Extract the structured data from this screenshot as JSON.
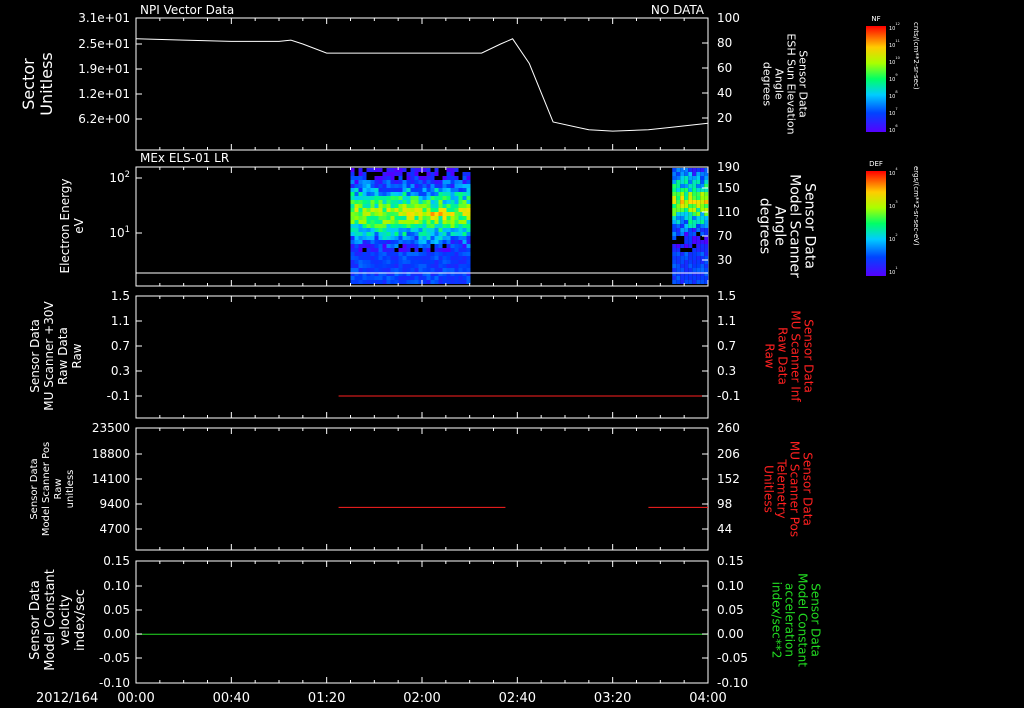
{
  "date_label": "2012/164",
  "time_ticks": [
    "00:00",
    "00:40",
    "01:20",
    "02:00",
    "02:40",
    "03:20",
    "04:00"
  ],
  "colors": {
    "red": "#ff2020",
    "green": "#22dd22",
    "white": "#ffffff"
  },
  "panels": [
    {
      "id": "sector",
      "title_left": "NPI Vector Data",
      "title_right": "NO DATA",
      "left_label": [
        "Sector",
        "Unitless"
      ],
      "right_label": [
        "Sensor Data",
        "ESH Sun Elevation",
        "Angle",
        "degrees"
      ],
      "left_ticks": [
        "3.1e+01",
        "2.5e+01",
        "1.9e+01",
        "1.2e+01",
        "6.2e+00"
      ],
      "right_ticks": [
        "100",
        "80",
        "60",
        "40",
        "20"
      ]
    },
    {
      "id": "els",
      "title_left": "MEx ELS-01 LR",
      "left_label": [
        "Electron Energy",
        "eV"
      ],
      "right_label": [
        "Sensor Data",
        "Model Scanner",
        "Angle",
        "degrees"
      ],
      "left_ticks": [
        "10^2",
        "10^1"
      ],
      "right_ticks": [
        "190",
        "150",
        "110",
        "70",
        "30"
      ]
    },
    {
      "id": "mu_raw",
      "left_label": [
        "Sensor Data",
        "MU Scanner +30V",
        "Raw Data",
        "Raw"
      ],
      "right_label": [
        "Sensor Data",
        "MU Scanner Inf",
        "Raw Data",
        "Raw"
      ],
      "left_ticks": [
        "1.5",
        "1.1",
        "0.7",
        "0.3",
        "-0.1"
      ],
      "right_ticks": [
        "1.5",
        "1.1",
        "0.7",
        "0.3",
        "-0.1"
      ]
    },
    {
      "id": "mu_pos",
      "left_label": [
        "Sensor Data",
        "Model Scanner Pos",
        "Raw",
        "unitless"
      ],
      "right_label": [
        "Sensor Data",
        "MU Scanner Pos",
        "Telemetry",
        "Unitless"
      ],
      "left_ticks": [
        "23500",
        "18800",
        "14100",
        "9400",
        "4700"
      ],
      "right_ticks": [
        "260",
        "206",
        "152",
        "98",
        "44"
      ]
    },
    {
      "id": "model_const",
      "left_label": [
        "Sensor Data",
        "Model Constant",
        "velocity",
        "index/sec"
      ],
      "right_label": [
        "Sensor Data",
        "Model Constant",
        "acceleration",
        "index/sec**2"
      ],
      "left_ticks": [
        "0.15",
        "0.10",
        "0.05",
        "0.00",
        "-0.05",
        "-0.10"
      ],
      "right_ticks": [
        "0.15",
        "0.10",
        "0.05",
        "0.00",
        "-0.05",
        "-0.10"
      ]
    }
  ],
  "colorbars": [
    {
      "name": "NF",
      "label": "cnts/(cm**2-sr-sec)",
      "ticks": [
        "10^12",
        "10^11",
        "10^10",
        "10^9",
        "10^8",
        "10^7",
        "10^6"
      ]
    },
    {
      "name": "DEF",
      "label": "ergs/(cm**2-sr-sec-eV)",
      "ticks": [
        "10^4",
        "10^3",
        "10^2",
        "10^1"
      ]
    }
  ],
  "chart_data": [
    {
      "type": "line",
      "title": "NPI Vector Data",
      "xlabel": "",
      "ylabel": "Sensor Data ESH Sun Elevation Angle degrees",
      "xlim": [
        "00:00",
        "04:00"
      ],
      "ylim": [
        0,
        100
      ],
      "x": [
        "00:00",
        "00:20",
        "00:40",
        "01:00",
        "01:05",
        "01:10",
        "01:20",
        "01:30",
        "01:45",
        "02:00",
        "02:15",
        "02:25",
        "02:33",
        "02:38",
        "02:45",
        "02:55",
        "03:10",
        "03:20",
        "03:35",
        "04:00"
      ],
      "values": [
        84,
        83,
        82,
        82,
        83,
        80,
        73,
        73,
        73,
        73,
        73,
        73,
        80,
        84,
        65,
        20,
        14,
        13,
        14,
        19
      ]
    },
    {
      "type": "heatmap",
      "title": "MEx ELS-01 LR",
      "ylabel": "Electron Energy eV",
      "yscale": "log",
      "data_blocks": [
        {
          "start": "01:30",
          "end": "02:20",
          "peak_energy_eV": [
            20,
            40
          ]
        },
        {
          "start": "03:45",
          "end": "04:00",
          "peak_energy_eV": [
            20,
            60
          ]
        }
      ],
      "overlay_line": {
        "name": "Sensor Data Model Scanner Angle",
        "value": "constant near bottom"
      }
    },
    {
      "type": "line",
      "ylabel": "Sensor Data MU Scanner Inf Raw Data Raw",
      "ylim": [
        -0.1,
        1.5
      ],
      "segments": [
        {
          "start": "01:25",
          "end": "04:00",
          "value": -0.1
        }
      ]
    },
    {
      "type": "line",
      "ylabel": "Sensor Data MU Scanner Pos Telemetry Unitless",
      "ylim": [
        0,
        23500
      ],
      "segments": [
        {
          "start": "01:25",
          "end": "02:35",
          "value": 8200
        },
        {
          "start": "03:35",
          "end": "04:00",
          "value": 8200
        }
      ]
    },
    {
      "type": "line",
      "ylabel": "Sensor Data Model Constant velocity index/sec",
      "ylim": [
        -0.1,
        0.15
      ],
      "segments": [
        {
          "start": "00:00",
          "end": "04:00",
          "value": 0.0
        }
      ]
    }
  ]
}
